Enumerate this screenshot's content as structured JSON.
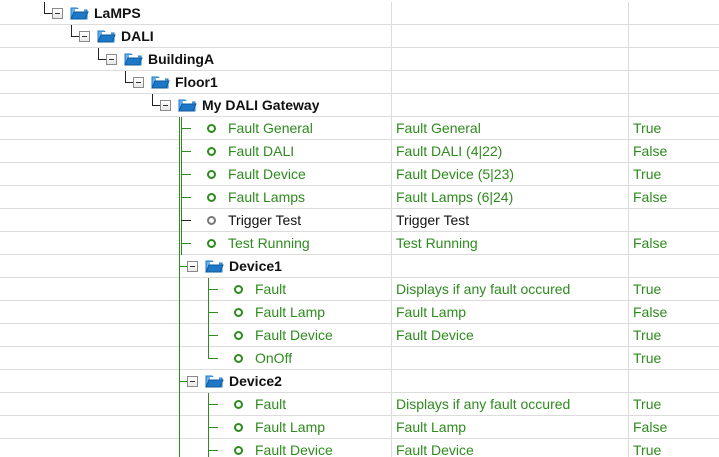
{
  "tree": {
    "rows": [
      {
        "label": "LaMPS",
        "kind": "folder",
        "depth": 0,
        "last": true
      },
      {
        "label": "DALI",
        "kind": "folder",
        "depth": 1,
        "last": true
      },
      {
        "label": "BuildingA",
        "kind": "folder",
        "depth": 2,
        "last": true
      },
      {
        "label": "Floor1",
        "kind": "folder",
        "depth": 3,
        "last": true
      },
      {
        "label": "My DALI Gateway",
        "kind": "folder",
        "depth": 4,
        "last": true
      },
      {
        "label": "Fault General",
        "kind": "item",
        "depth": 5,
        "description": "Fault General",
        "value": "True",
        "color": "green"
      },
      {
        "label": "Fault DALI",
        "kind": "item",
        "depth": 5,
        "description": "Fault DALI (4|22)",
        "value": "False",
        "color": "green"
      },
      {
        "label": "Fault Device",
        "kind": "item",
        "depth": 5,
        "description": "Fault Device (5|23)",
        "value": "True",
        "color": "green"
      },
      {
        "label": "Fault Lamps",
        "kind": "item",
        "depth": 5,
        "description": "Fault Lamps (6|24)",
        "value": "False",
        "color": "green"
      },
      {
        "label": "Trigger Test",
        "kind": "item",
        "depth": 5,
        "description": "Trigger Test",
        "value": "",
        "color": "black"
      },
      {
        "label": "Test Running",
        "kind": "item",
        "depth": 5,
        "description": "Test Running",
        "value": "False",
        "color": "green"
      },
      {
        "label": "Device1",
        "kind": "folder",
        "depth": 5,
        "last": false
      },
      {
        "label": "Fault",
        "kind": "item",
        "depth": 6,
        "description": "Displays if any fault occured",
        "value": "True",
        "color": "green"
      },
      {
        "label": "Fault Lamp",
        "kind": "item",
        "depth": 6,
        "description": "Fault Lamp",
        "value": "False",
        "color": "green"
      },
      {
        "label": "Fault Device",
        "kind": "item",
        "depth": 6,
        "description": "Fault Device",
        "value": "True",
        "color": "green"
      },
      {
        "label": "OnOff",
        "kind": "item",
        "depth": 6,
        "description": "",
        "value": "True",
        "color": "green",
        "last": true
      },
      {
        "label": "Device2",
        "kind": "folder",
        "depth": 5,
        "last": false
      },
      {
        "label": "Fault",
        "kind": "item",
        "depth": 6,
        "description": "Displays if any fault occured",
        "value": "True",
        "color": "green"
      },
      {
        "label": "Fault Lamp",
        "kind": "item",
        "depth": 6,
        "description": "Fault Lamp",
        "value": "False",
        "color": "green"
      },
      {
        "label": "Fault Device",
        "kind": "item",
        "depth": 6,
        "description": "Fault Device",
        "value": "True",
        "color": "green"
      }
    ]
  },
  "colors": {
    "green": "#2e8b1e",
    "black": "#111111",
    "folder_blue": "#1e78c8",
    "gridline": "#dcdcdc"
  },
  "icons": {
    "expander": "minus-box-icon",
    "folder": "folder-icon",
    "item": "circle-icon"
  }
}
